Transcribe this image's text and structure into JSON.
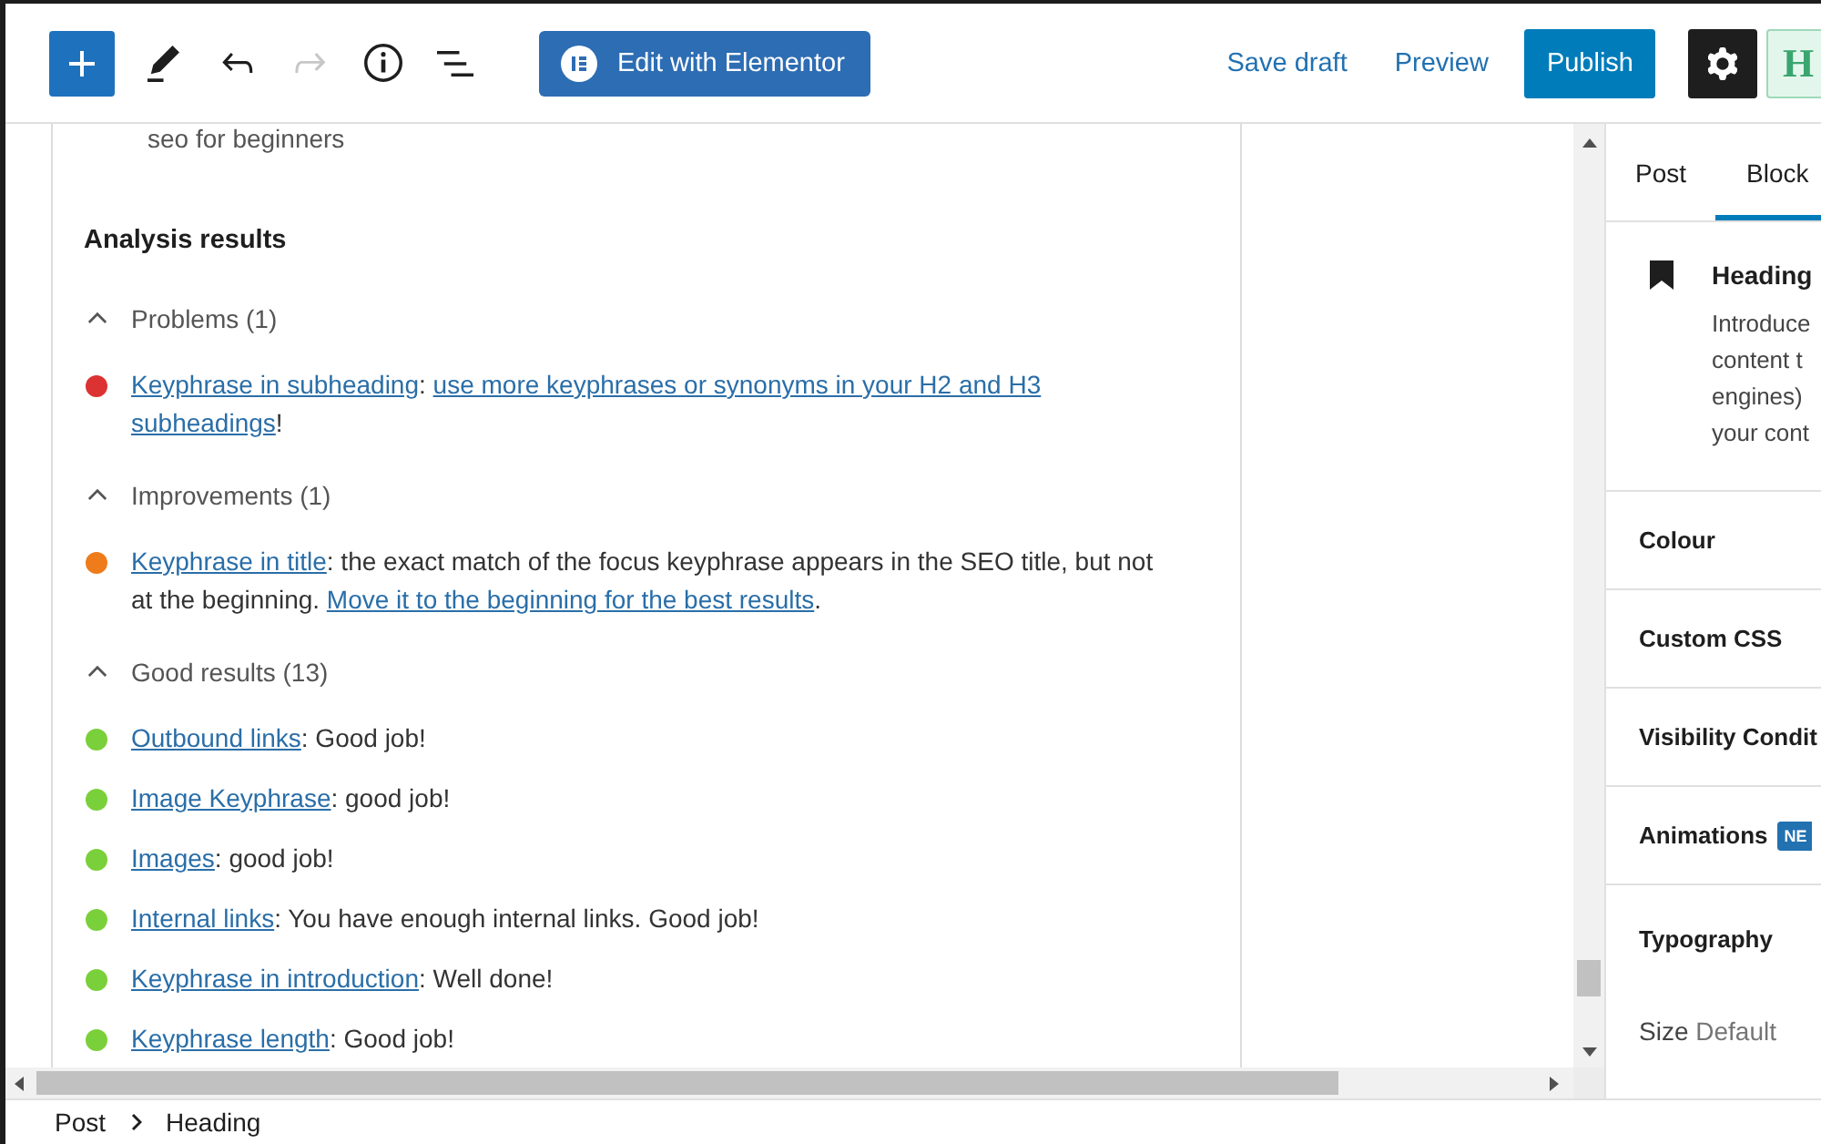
{
  "toolbar": {
    "tools": [
      {
        "kind": "add",
        "disabled": false
      },
      {
        "kind": "pencil",
        "disabled": false
      },
      {
        "kind": "undo",
        "disabled": false
      },
      {
        "kind": "redo",
        "disabled": true
      },
      {
        "kind": "info",
        "disabled": false
      },
      {
        "kind": "list",
        "disabled": false
      }
    ],
    "elementor_button": "Edit with Elementor",
    "save_draft": "Save draft",
    "preview": "Preview",
    "publish": "Publish",
    "settings": {
      "pressed": true
    },
    "plugin_button": "H"
  },
  "editor": {
    "keyphrase": "seo for beginners",
    "analysis": {
      "title": "Analysis results",
      "groups": [
        {
          "label": "Problems (1)",
          "expanded": true,
          "results": [
            {
              "color": "#dc3232",
              "segments": [
                {
                  "kind": "link",
                  "text": "Keyphrase in subheading"
                },
                {
                  "kind": "text",
                  "text": ": "
                },
                {
                  "kind": "link",
                  "text": "use more keyphrases or synonyms in your H2 and H3 "
                },
                {
                  "kind": "link",
                  "text": "subheadings"
                },
                {
                  "kind": "text",
                  "text": "!"
                }
              ]
            }
          ]
        },
        {
          "label": "Improvements (1)",
          "expanded": true,
          "results": [
            {
              "color": "#ee7c1b",
              "segments": [
                {
                  "kind": "link",
                  "text": "Keyphrase in title"
                },
                {
                  "kind": "text",
                  "text": ": the exact match of the focus keyphrase appears in the SEO title, but not at the beginning. "
                },
                {
                  "kind": "link",
                  "text": "Move it to the beginning for the best results"
                },
                {
                  "kind": "text",
                  "text": "."
                }
              ]
            }
          ]
        },
        {
          "label": "Good results (13)",
          "expanded": true,
          "results": [
            {
              "color": "#7ad03a",
              "segments": [
                {
                  "kind": "link",
                  "text": "Outbound links"
                },
                {
                  "kind": "text",
                  "text": ": Good job!"
                }
              ]
            },
            {
              "color": "#7ad03a",
              "segments": [
                {
                  "kind": "link",
                  "text": "Image Keyphrase"
                },
                {
                  "kind": "text",
                  "text": ": good job!"
                }
              ]
            },
            {
              "color": "#7ad03a",
              "segments": [
                {
                  "kind": "link",
                  "text": "Images"
                },
                {
                  "kind": "text",
                  "text": ": good job!"
                }
              ]
            },
            {
              "color": "#7ad03a",
              "segments": [
                {
                  "kind": "link",
                  "text": "Internal links"
                },
                {
                  "kind": "text",
                  "text": ": You have enough internal links. Good job!"
                }
              ]
            },
            {
              "color": "#7ad03a",
              "segments": [
                {
                  "kind": "link",
                  "text": "Keyphrase in introduction"
                },
                {
                  "kind": "text",
                  "text": ": Well done!"
                }
              ]
            },
            {
              "color": "#7ad03a",
              "segments": [
                {
                  "kind": "link",
                  "text": "Keyphrase length"
                },
                {
                  "kind": "text",
                  "text": ": Good job!"
                }
              ]
            }
          ]
        }
      ]
    }
  },
  "sidebar": {
    "tabs": [
      {
        "label": "Post",
        "selected": false
      },
      {
        "label": "Block",
        "selected": true
      }
    ],
    "block": {
      "title": "Heading",
      "description_lines": [
        "Introduce",
        "content t",
        "engines)",
        "your cont"
      ]
    },
    "panels": [
      {
        "title": "Colour"
      },
      {
        "title": "Custom CSS"
      },
      {
        "title": "Visibility Condit"
      },
      {
        "title": "Animations",
        "badge": "NE"
      }
    ],
    "typography": {
      "title": "Typography",
      "size_label": "Size",
      "size_value": "Default"
    }
  },
  "breadcrumb": [
    "Post",
    "Heading"
  ]
}
